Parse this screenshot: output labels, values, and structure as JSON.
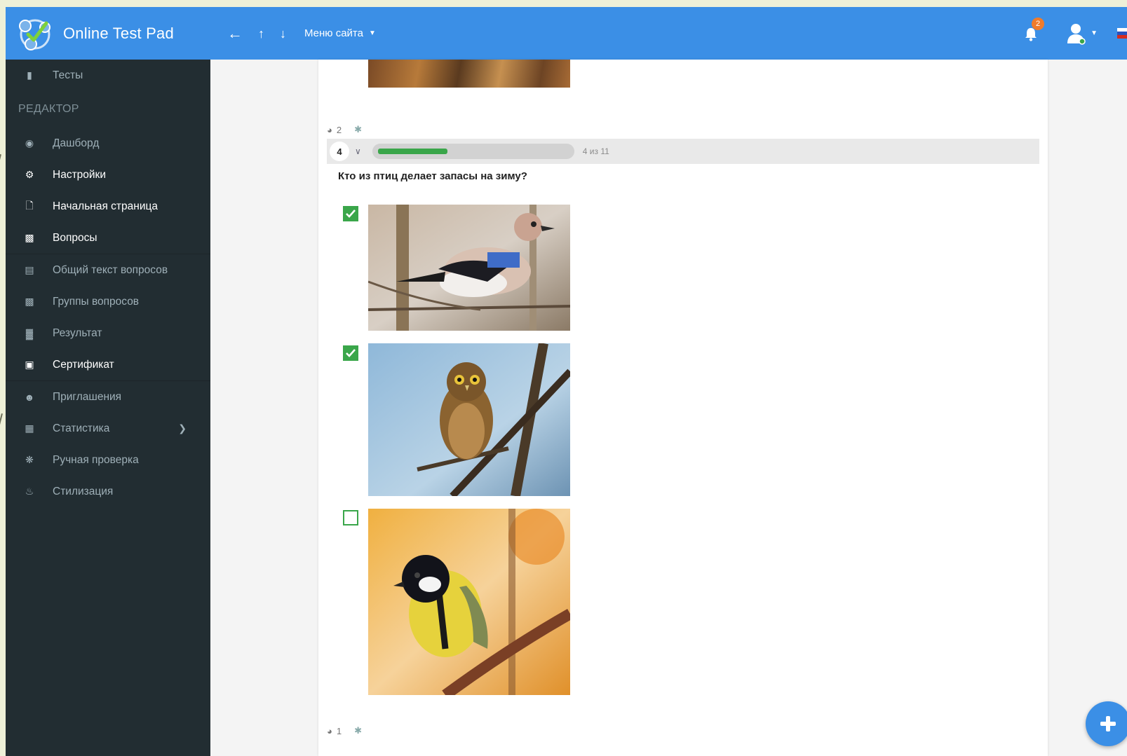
{
  "app": {
    "title": "Online Test Pad",
    "site_menu": "Меню сайта",
    "notifications_count": "2"
  },
  "colors": {
    "topbar": "#3b8fe6",
    "sidebar": "#222d32",
    "accent_green": "#3aa64a",
    "badge": "#f07b2a"
  },
  "sidebar": {
    "tests": "Тесты",
    "editor_header": "РЕДАКТОР",
    "items": [
      {
        "label": "Дашборд",
        "icon": "dashboard-icon",
        "bright": false
      },
      {
        "label": "Настройки",
        "icon": "gear-icon",
        "bright": true
      },
      {
        "label": "Начальная страница",
        "icon": "file-icon",
        "bright": true
      },
      {
        "label": "Вопросы",
        "icon": "comment-icon",
        "bright": true
      },
      {
        "label": "Общий текст вопросов",
        "icon": "text-file-icon",
        "bright": false
      },
      {
        "label": "Группы вопросов",
        "icon": "groups-icon",
        "bright": false
      },
      {
        "label": "Результат",
        "icon": "bar-chart-icon",
        "bright": false
      },
      {
        "label": "Сертификат",
        "icon": "certificate-icon",
        "bright": true
      },
      {
        "label": "Приглашения",
        "icon": "add-user-icon",
        "bright": false
      },
      {
        "label": "Статистика",
        "icon": "stats-icon",
        "bright": false
      },
      {
        "label": "Ручная проверка",
        "icon": "gears-icon",
        "bright": false
      },
      {
        "label": "Стилизация",
        "icon": "paint-icon",
        "bright": false
      }
    ]
  },
  "question_prev_meta": {
    "points": "2"
  },
  "question": {
    "number": "4",
    "progress_fraction": 0.364,
    "count_text": "4 из 11",
    "text": "Кто из птиц делает запасы на зиму?",
    "answers": [
      {
        "image": "jay-bird-photo",
        "checked": true
      },
      {
        "image": "owl-photo",
        "checked": true
      },
      {
        "image": "great-tit-photo",
        "checked": false
      }
    ]
  },
  "question_next_meta": {
    "points": "1"
  }
}
